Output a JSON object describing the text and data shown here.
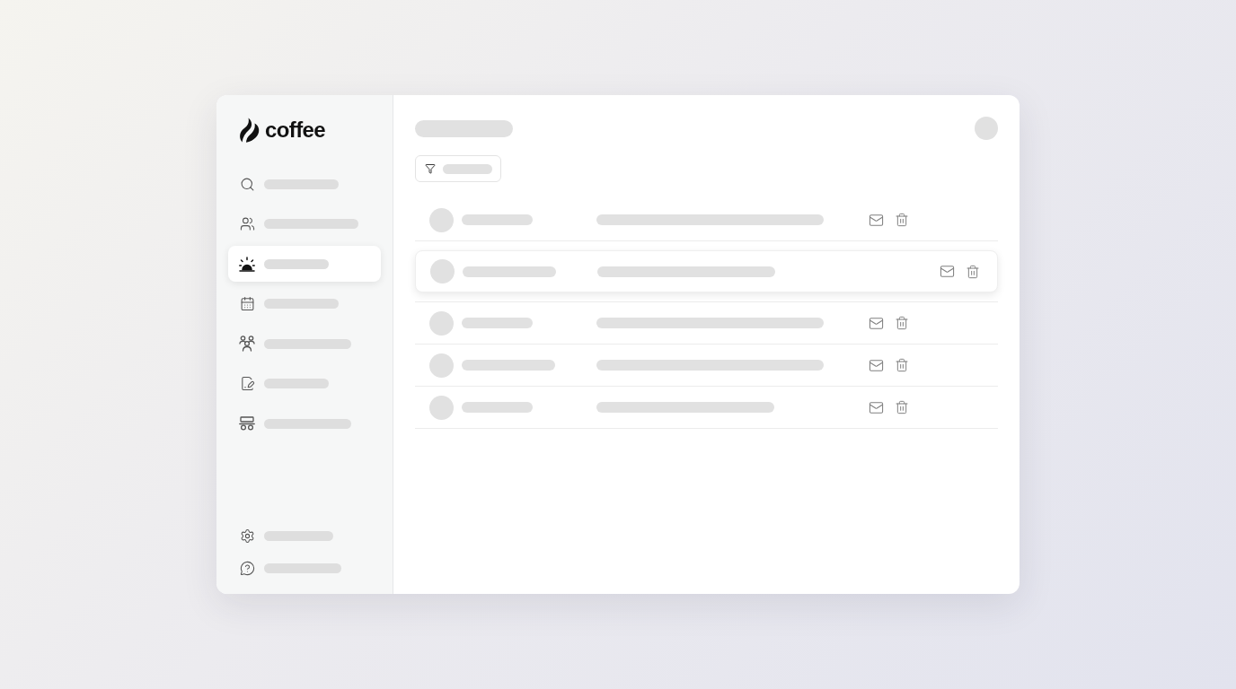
{
  "logo": {
    "text": "coffee"
  },
  "sidebar": {
    "items": [
      {
        "selected": false
      },
      {
        "selected": false
      },
      {
        "selected": true
      },
      {
        "selected": false
      },
      {
        "selected": false
      },
      {
        "selected": false
      },
      {
        "selected": false
      }
    ],
    "footer_items": [
      {
        "selected": false
      },
      {
        "selected": false
      }
    ]
  },
  "main": {
    "rows": [
      {
        "selected": false
      },
      {
        "selected": true
      },
      {
        "selected": false
      },
      {
        "selected": false
      },
      {
        "selected": false
      }
    ]
  }
}
